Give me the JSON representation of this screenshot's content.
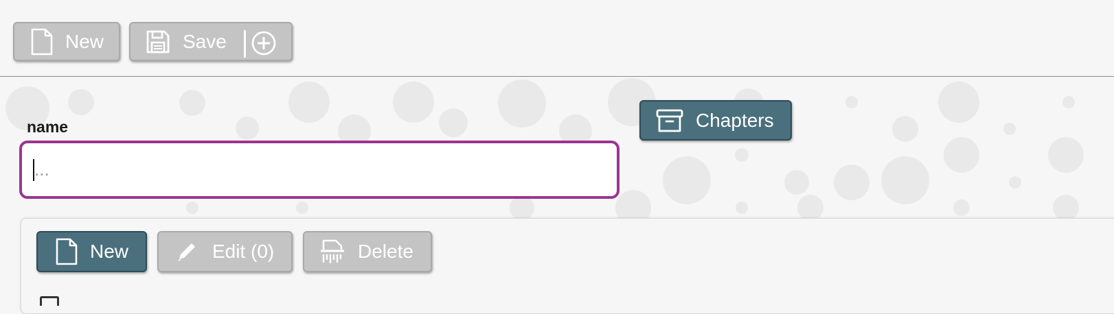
{
  "toolbar": {
    "new_label": "New",
    "save_label": "Save",
    "new_icon": "document-icon",
    "save_icon": "floppy-disk-icon",
    "save_add_icon": "plus-circle-icon"
  },
  "form": {
    "name_label": "name",
    "name_value": "",
    "name_placeholder": "..."
  },
  "chapters_button": {
    "label": "Chapters",
    "icon": "archive-box-icon"
  },
  "list_toolbar": {
    "new_label": "New",
    "edit_label": "Edit (0)",
    "delete_label": "Delete",
    "new_icon": "document-icon",
    "edit_icon": "pencil-icon",
    "delete_icon": "shredder-icon"
  },
  "colors": {
    "primary": "#4a6f7d",
    "disabled": "#c4c4c4",
    "focus_border": "#9b3592",
    "background": "#f6f6f6"
  }
}
